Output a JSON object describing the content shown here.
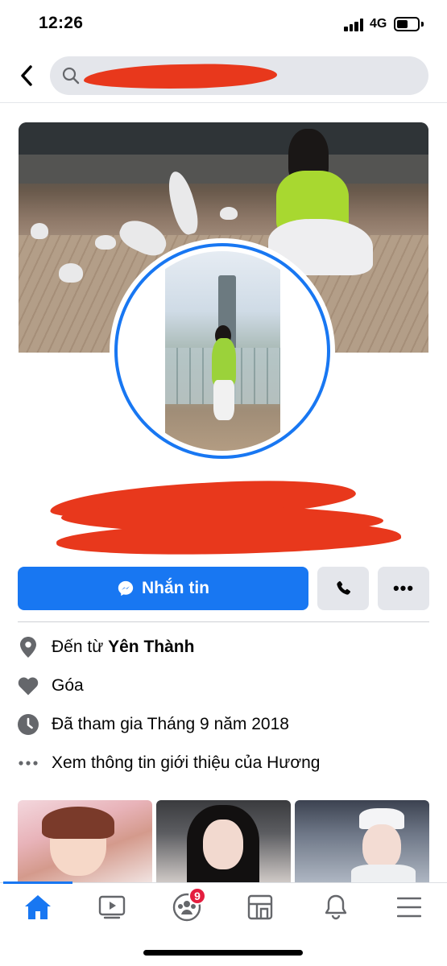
{
  "status_bar": {
    "time": "12:26",
    "network": "4G",
    "battery_level": 0.55
  },
  "header": {
    "back_icon": "chevron-left-icon",
    "search_icon": "search-icon"
  },
  "profile": {
    "message_button_label": "Nhắn tin",
    "message_icon": "messenger-icon",
    "call_icon": "phone-icon",
    "more_label": "•••"
  },
  "info": {
    "hometown_prefix": "Đến từ",
    "hometown": "Yên Thành",
    "relationship": "Góa",
    "joined": "Đã tham gia Tháng 9 năm 2018",
    "see_about": "Xem thông tin giới thiệu của Hương"
  },
  "nav": {
    "items": [
      "home-icon",
      "video-icon",
      "groups-icon",
      "marketplace-icon",
      "bell-icon",
      "menu-icon"
    ],
    "groups_badge": "9"
  },
  "colors": {
    "accent": "#1877f2",
    "redaction": "#e8381c",
    "badge": "#e41e3f"
  }
}
